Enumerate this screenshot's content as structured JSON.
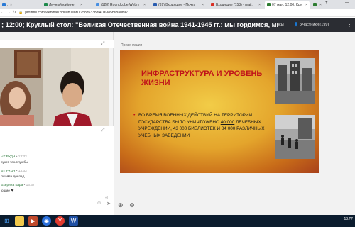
{
  "browser": {
    "tabs": [
      {
        "label": "...",
        "color": "#2b7bd6",
        "active": false
      },
      {
        "label": "Личный кабинет",
        "color": "#1f8a4c",
        "active": false
      },
      {
        "label": "(128) Roundcube Webm",
        "color": "#4a90e2",
        "active": false
      },
      {
        "label": "(39) Входящие - Почта",
        "color": "#2a5db0",
        "active": false
      },
      {
        "label": "Входящие (153) - mail.r",
        "color": "#d93025",
        "active": false
      },
      {
        "label": "07 мая, 12:00; Кругл",
        "color": "#2e7d32",
        "active": true
      },
      {
        "label": "",
        "color": "#2e7d32",
        "active": false
      }
    ],
    "new_tab": "+",
    "url": "proffme.com/webinar/?id=0b0e8f1c758d53388f4f16385b68a0897"
  },
  "webinar": {
    "title": "; 12:00; Круглый стол: \"Великая Отечественная война 1941-1945 гг.: мы гордимся, мы помним\"",
    "polls_label": "осы",
    "participants_label": "Участники (199)",
    "presentation_label": "Презентация"
  },
  "chat": {
    "messages": [
      {
        "name": "ыТ РУДН",
        "time": "• 13:33",
        "text": "рукэт тех.службы"
      },
      {
        "name": "ыТ РУДН",
        "time": "• 13:33",
        "text": "лжайте доклад"
      },
      {
        "name": "ыхерина Кара",
        "time": "• 13:37",
        "text": "ющие ❤"
      }
    ],
    "page_indicator": "«|"
  },
  "slide": {
    "title": "ИНФРАСТРУКТУРА И УРОВЕНЬ ЖИЗНИ",
    "bullet": "ВО ВРЕМЯ ВОЕННЫХ ДЕЙСТВИЙ НА ТЕРРИТОРИИ ГОСУДАРСТВА БЫЛО УНИЧТОЖЕНО 40 000 ЛЕЧЕБНЫХ УЧРЕЖДЕНИЙ, 43 000 БИБЛИОТЕК И 84 000 РАЗЛИЧНЫХ УЧЕБНЫХ ЗАВЕДЕНИЙ",
    "bullet_parts": {
      "p1": "ВО ВРЕМЯ ВОЕННЫХ ДЕЙСТВИЙ НА ТЕРРИТОРИИ ГОСУДАРСТВА БЫЛО УНИЧТОЖЕНО ",
      "n1": "40 000",
      "p2": " ЛЕЧЕБНЫХ УЧРЕЖДЕНИЙ, ",
      "n2": "43 000",
      "p3": " БИБЛИОТЕК И ",
      "n3": "84 000",
      "p4": " РАЗЛИЧНЫХ УЧЕБНЫХ ЗАВЕДЕНИЙ"
    },
    "colors": {
      "title": "#c0131a",
      "text": "#1a1a1a"
    }
  },
  "taskbar": {
    "apps": [
      "start",
      "explorer",
      "media",
      "chrome",
      "yandex",
      "word"
    ],
    "clock": "13:??"
  }
}
